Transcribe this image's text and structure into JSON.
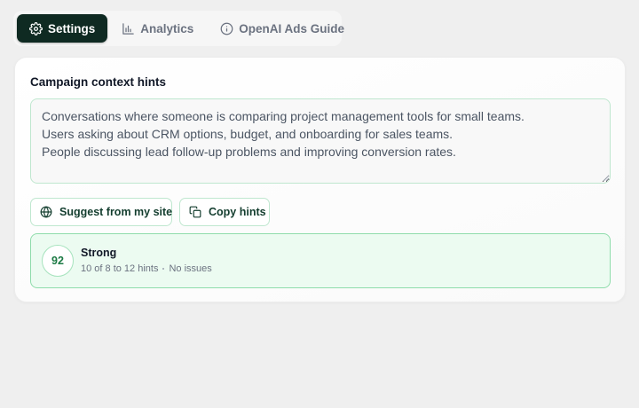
{
  "tabs": [
    {
      "label": "Settings",
      "icon": "gear-icon",
      "active": true
    },
    {
      "label": "Analytics",
      "icon": "bar-chart-icon",
      "active": false
    },
    {
      "label": "OpenAI Ads Guide",
      "icon": "info-icon",
      "active": false
    }
  ],
  "campaign": {
    "section_label": "Campaign context hints",
    "hints_text": "Conversations where someone is comparing project management tools for small teams.\nUsers asking about CRM options, budget, and onboarding for sales teams.\nPeople discussing lead follow-up problems and improving conversion rates."
  },
  "actions": {
    "suggest_label": "Suggest from my site",
    "suggest_icon": "globe-icon",
    "copy_label": "Copy hints",
    "copy_icon": "copy-icon"
  },
  "score": {
    "value": "92",
    "rating": "Strong",
    "hint_count": "10 of 8 to 12 hints",
    "issues": "No issues"
  },
  "colors": {
    "active_tab_bg": "#0f2a22",
    "accent_green": "#1c7a44",
    "score_bg": "#ecfbf1",
    "border_green": "#bfe7cf"
  }
}
